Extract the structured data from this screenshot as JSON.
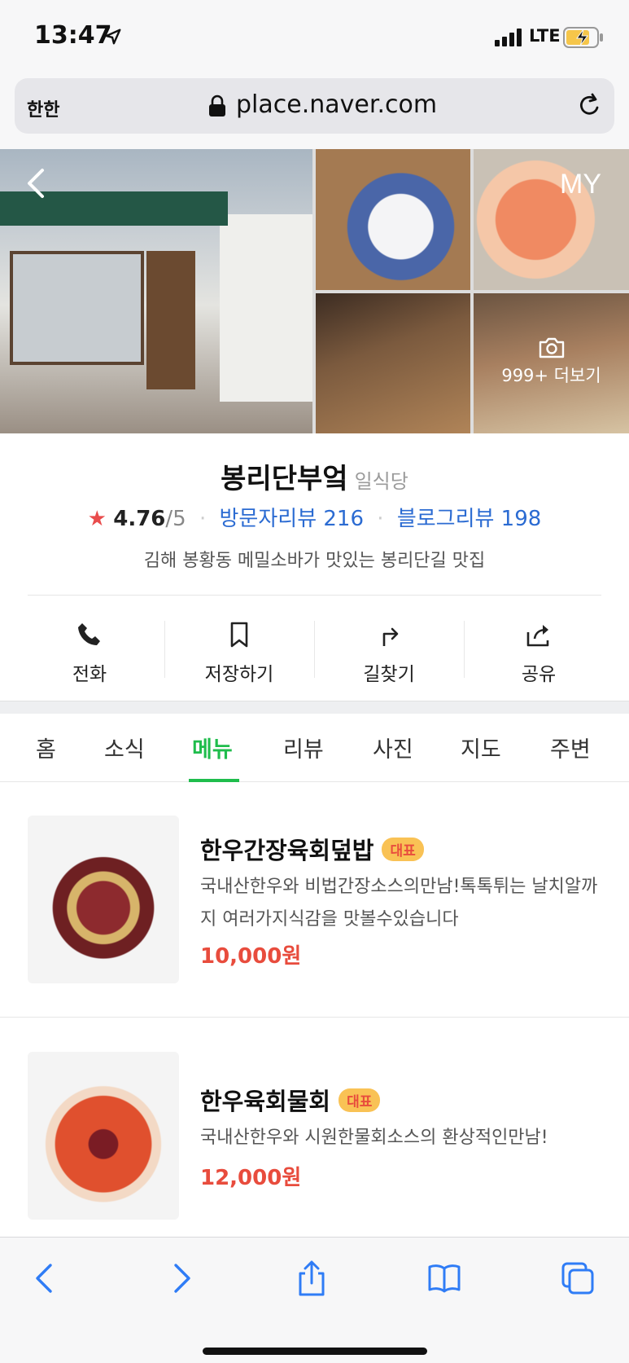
{
  "status_bar": {
    "time": "13:47",
    "network": "LTE"
  },
  "address_bar": {
    "text_size_button": "한한",
    "url": "place.naver.com"
  },
  "photos": {
    "my_label": "MY",
    "more_label": "999+ 더보기"
  },
  "place": {
    "name": "봉리단부엌",
    "category": "일식당",
    "rating": "4.76",
    "rating_max": "/5",
    "visitor_reviews": "방문자리뷰 216",
    "blog_reviews": "블로그리뷰 198",
    "description": "김해 봉황동 메밀소바가 맛있는 봉리단길 맛집"
  },
  "actions": [
    {
      "label": "전화",
      "icon": "phone-icon"
    },
    {
      "label": "저장하기",
      "icon": "bookmark-icon"
    },
    {
      "label": "길찾기",
      "icon": "directions-icon"
    },
    {
      "label": "공유",
      "icon": "share-icon"
    }
  ],
  "tabs": [
    "홈",
    "소식",
    "메뉴",
    "리뷰",
    "사진",
    "지도",
    "주변"
  ],
  "active_tab": "메뉴",
  "menu": [
    {
      "name": "한우간장육회덮밥",
      "badge": "대표",
      "description": "국내산한우와 비법간장소스의만남!톡톡튀는 날치알까지 여러가지식감을 맛볼수있습니다",
      "price": "10,000원"
    },
    {
      "name": "한우육회물회",
      "badge": "대표",
      "description": "국내산한우와 시원한물회소스의 환상적인만남!",
      "price": "12,000원"
    }
  ],
  "colors": {
    "accent_green": "#1fbd4c",
    "link_blue": "#2b6bd2",
    "price_red": "#e84c3d",
    "badge_yellow": "#f9c255",
    "star_red": "#e94c4c"
  }
}
